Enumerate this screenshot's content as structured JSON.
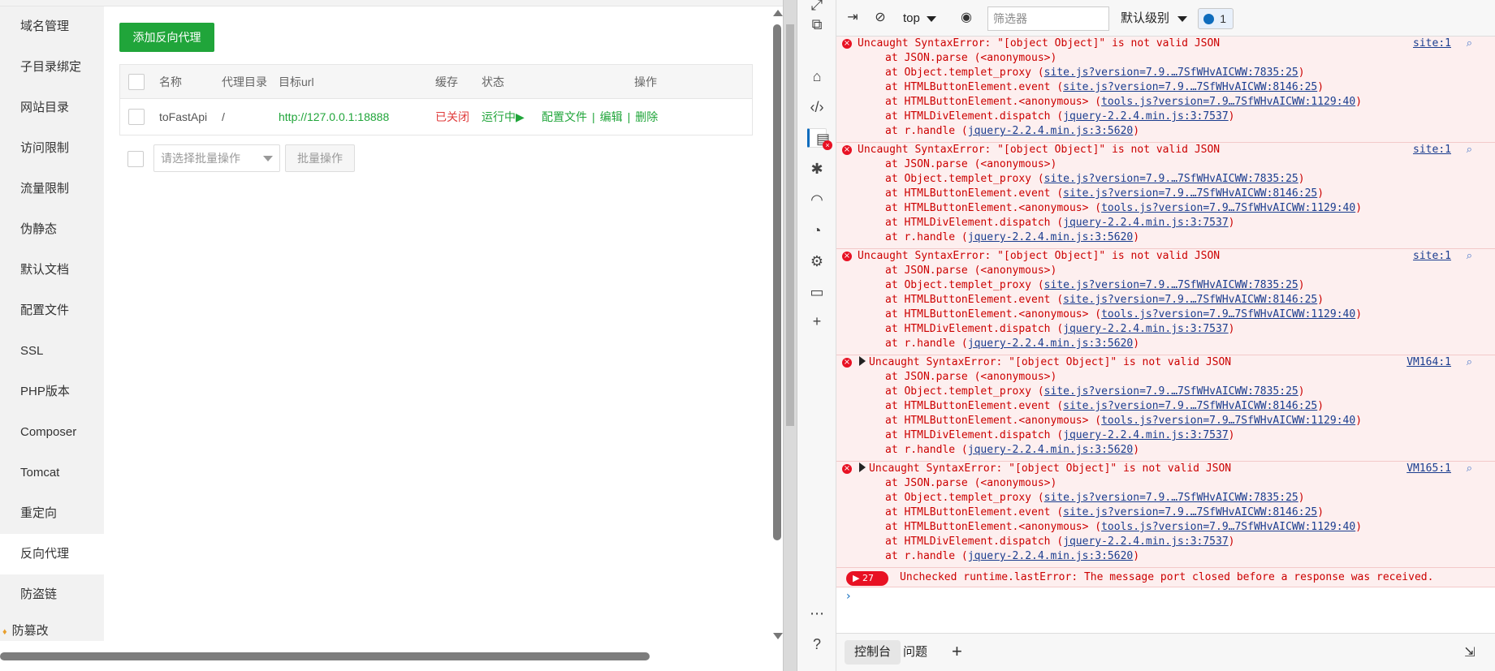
{
  "left_panel": {
    "sidebar": {
      "items": [
        {
          "label": "域名管理"
        },
        {
          "label": "子目录绑定"
        },
        {
          "label": "网站目录"
        },
        {
          "label": "访问限制"
        },
        {
          "label": "流量限制"
        },
        {
          "label": "伪静态"
        },
        {
          "label": "默认文档"
        },
        {
          "label": "配置文件"
        },
        {
          "label": "SSL"
        },
        {
          "label": "PHP版本"
        },
        {
          "label": "Composer"
        },
        {
          "label": "Tomcat"
        },
        {
          "label": "重定向"
        },
        {
          "label": "反向代理",
          "active": true
        },
        {
          "label": "防盗链"
        },
        {
          "label": "防篡改"
        }
      ]
    },
    "add_button": "添加反向代理",
    "table": {
      "headers": {
        "name": "名称",
        "dir": "代理目录",
        "url": "目标url",
        "cache": "缓存",
        "status": "状态",
        "ops": "操作"
      },
      "rows": [
        {
          "name": "toFastApi",
          "dir": "/",
          "url": "http://127.0.0.1:18888",
          "cache": "已关闭",
          "status": "运行中▶",
          "op_config": "配置文件",
          "op_edit": "编辑",
          "op_delete": "删除",
          "op_sep": "|"
        }
      ]
    },
    "batch": {
      "placeholder": "请选择批量操作",
      "button": "批量操作"
    }
  },
  "devtools": {
    "toolbar": {
      "context": "top",
      "filter_placeholder": "筛选器",
      "level": "默认级别",
      "message_count": "1"
    },
    "errors": [
      {
        "message": "Uncaught SyntaxError: \"[object Object]\" is not valid JSON",
        "source": "site:1",
        "expandable": false,
        "stack": [
          {
            "prefix": "at JSON.parse (<anonymous>)",
            "link": "",
            "suffix": ""
          },
          {
            "prefix": "at Object.templet_proxy (",
            "link": "site.js?version=7.9.…7SfWHvAICWW:7835:25",
            "suffix": ")"
          },
          {
            "prefix": "at HTMLButtonElement.event (",
            "link": "site.js?version=7.9.…7SfWHvAICWW:8146:25",
            "suffix": ")"
          },
          {
            "prefix": "at HTMLButtonElement.<anonymous> (",
            "link": "tools.js?version=7.9…7SfWHvAICWW:1129:40",
            "suffix": ")"
          },
          {
            "prefix": "at HTMLDivElement.dispatch (",
            "link": "jquery-2.2.4.min.js:3:7537",
            "suffix": ")"
          },
          {
            "prefix": "at r.handle (",
            "link": "jquery-2.2.4.min.js:3:5620",
            "suffix": ")"
          }
        ]
      },
      {
        "message": "Uncaught SyntaxError: \"[object Object]\" is not valid JSON",
        "source": "site:1",
        "expandable": false,
        "stack": [
          {
            "prefix": "at JSON.parse (<anonymous>)",
            "link": "",
            "suffix": ""
          },
          {
            "prefix": "at Object.templet_proxy (",
            "link": "site.js?version=7.9.…7SfWHvAICWW:7835:25",
            "suffix": ")"
          },
          {
            "prefix": "at HTMLButtonElement.event (",
            "link": "site.js?version=7.9.…7SfWHvAICWW:8146:25",
            "suffix": ")"
          },
          {
            "prefix": "at HTMLButtonElement.<anonymous> (",
            "link": "tools.js?version=7.9…7SfWHvAICWW:1129:40",
            "suffix": ")"
          },
          {
            "prefix": "at HTMLDivElement.dispatch (",
            "link": "jquery-2.2.4.min.js:3:7537",
            "suffix": ")"
          },
          {
            "prefix": "at r.handle (",
            "link": "jquery-2.2.4.min.js:3:5620",
            "suffix": ")"
          }
        ]
      },
      {
        "message": "Uncaught SyntaxError: \"[object Object]\" is not valid JSON",
        "source": "site:1",
        "expandable": false,
        "stack": [
          {
            "prefix": "at JSON.parse (<anonymous>)",
            "link": "",
            "suffix": ""
          },
          {
            "prefix": "at Object.templet_proxy (",
            "link": "site.js?version=7.9.…7SfWHvAICWW:7835:25",
            "suffix": ")"
          },
          {
            "prefix": "at HTMLButtonElement.event (",
            "link": "site.js?version=7.9.…7SfWHvAICWW:8146:25",
            "suffix": ")"
          },
          {
            "prefix": "at HTMLButtonElement.<anonymous> (",
            "link": "tools.js?version=7.9…7SfWHvAICWW:1129:40",
            "suffix": ")"
          },
          {
            "prefix": "at HTMLDivElement.dispatch (",
            "link": "jquery-2.2.4.min.js:3:7537",
            "suffix": ")"
          },
          {
            "prefix": "at r.handle (",
            "link": "jquery-2.2.4.min.js:3:5620",
            "suffix": ")"
          }
        ]
      },
      {
        "message": "Uncaught SyntaxError: \"[object Object]\" is not valid JSON",
        "source": "VM164:1",
        "expandable": true,
        "stack": [
          {
            "prefix": "at JSON.parse (<anonymous>)",
            "link": "",
            "suffix": ""
          },
          {
            "prefix": "at Object.templet_proxy (",
            "link": "site.js?version=7.9.…7SfWHvAICWW:7835:25",
            "suffix": ")"
          },
          {
            "prefix": "at HTMLButtonElement.event (",
            "link": "site.js?version=7.9.…7SfWHvAICWW:8146:25",
            "suffix": ")"
          },
          {
            "prefix": "at HTMLButtonElement.<anonymous> (",
            "link": "tools.js?version=7.9…7SfWHvAICWW:1129:40",
            "suffix": ")"
          },
          {
            "prefix": "at HTMLDivElement.dispatch (",
            "link": "jquery-2.2.4.min.js:3:7537",
            "suffix": ")"
          },
          {
            "prefix": "at r.handle (",
            "link": "jquery-2.2.4.min.js:3:5620",
            "suffix": ")"
          }
        ]
      },
      {
        "message": "Uncaught SyntaxError: \"[object Object]\" is not valid JSON",
        "source": "VM165:1",
        "expandable": true,
        "stack": [
          {
            "prefix": "at JSON.parse (<anonymous>)",
            "link": "",
            "suffix": ""
          },
          {
            "prefix": "at Object.templet_proxy (",
            "link": "site.js?version=7.9.…7SfWHvAICWW:7835:25",
            "suffix": ")"
          },
          {
            "prefix": "at HTMLButtonElement.event (",
            "link": "site.js?version=7.9.…7SfWHvAICWW:8146:25",
            "suffix": ")"
          },
          {
            "prefix": "at HTMLButtonElement.<anonymous> (",
            "link": "tools.js?version=7.9…7SfWHvAICWW:1129:40",
            "suffix": ")"
          },
          {
            "prefix": "at HTMLDivElement.dispatch (",
            "link": "jquery-2.2.4.min.js:3:7537",
            "suffix": ")"
          },
          {
            "prefix": "at r.handle (",
            "link": "jquery-2.2.4.min.js:3:5620",
            "suffix": ")"
          }
        ]
      }
    ],
    "runtime_error": {
      "count": "27",
      "message": "Unchecked runtime.lastError: The message port closed before a response was received."
    },
    "prompt": "›",
    "bottom_tabs": [
      {
        "label": "控制台",
        "active": true
      },
      {
        "label": "问题",
        "active": false
      }
    ]
  }
}
